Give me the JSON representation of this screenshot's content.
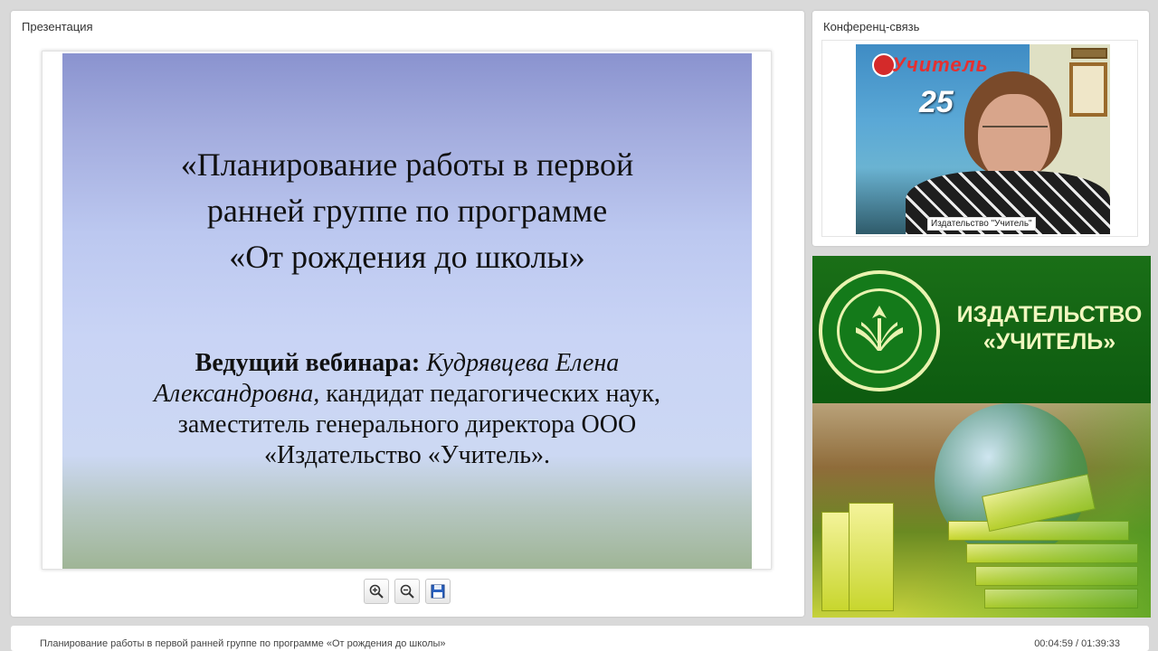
{
  "presentation": {
    "panel_title": "Презентация",
    "slide": {
      "title_line1": "«Планирование работы в первой",
      "title_line2": "ранней группе по программе",
      "title_line3": "«От рождения до школы»",
      "presenter_label": "Ведущий вебинара:",
      "presenter_name1": "Кудрявцева Елена",
      "presenter_name2": "Александровна,",
      "presenter_rest1": " кандидат педагогических наук,",
      "presenter_rest2": "заместитель генерального директора ООО",
      "presenter_rest3": "«Издательство «Учитель»."
    },
    "toolbar": {
      "zoom_in_icon": "zoom-in-icon",
      "zoom_out_icon": "zoom-out-icon",
      "save_icon": "floppy-save-icon"
    }
  },
  "conference": {
    "panel_title": "Конференц-связь",
    "video_caption": "Издательство \"Учитель\"",
    "poster_logo": "Учитель",
    "poster_number": "25"
  },
  "banner": {
    "line1": "ИЗДАТЕЛЬСТВО",
    "line2": "«УЧИТЕЛЬ»"
  },
  "footer": {
    "title": "Планирование работы в первой ранней группе по программе «От рождения до школы»",
    "time": "00:04:59 / 01:39:33"
  },
  "colors": {
    "banner_green": "#0d5b10",
    "banner_text": "#f1f7c0",
    "background": "#d9d9d9"
  }
}
